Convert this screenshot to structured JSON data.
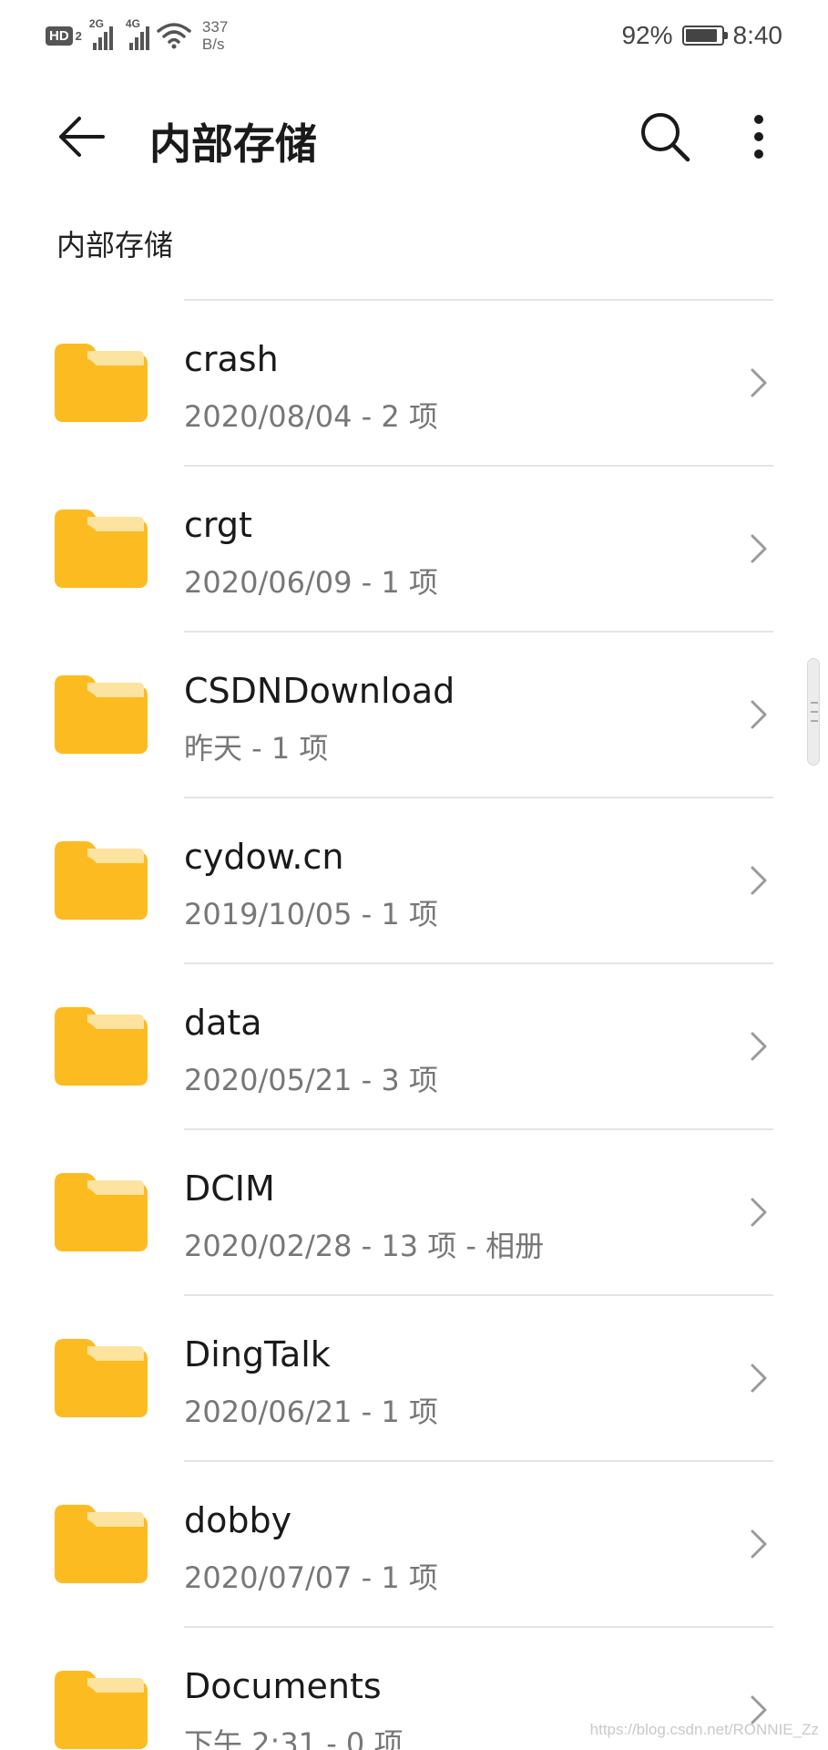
{
  "status_bar": {
    "hd_label": "HD",
    "hd_sub": "2",
    "net1": "2G",
    "net2": "4G",
    "speed_value": "337",
    "speed_unit": "B/s",
    "battery_percent": "92%",
    "battery_level": 0.92,
    "time": "8:40"
  },
  "app_bar": {
    "title": "内部存储",
    "back_icon": "arrow-left-icon",
    "search_icon": "search-icon",
    "more_icon": "more-vertical-icon"
  },
  "breadcrumb": "内部存储",
  "folder_color": "#FDBB22",
  "items": [
    {
      "name": "crash",
      "meta": "2020/08/04 - 2 项"
    },
    {
      "name": "crgt",
      "meta": "2020/06/09 - 1 项"
    },
    {
      "name": "CSDNDownload",
      "meta": "昨天 - 1 项"
    },
    {
      "name": "cydow.cn",
      "meta": "2019/10/05 - 1 项"
    },
    {
      "name": "data",
      "meta": "2020/05/21 - 3 项"
    },
    {
      "name": "DCIM",
      "meta": "2020/02/28 - 13 项 - 相册"
    },
    {
      "name": "DingTalk",
      "meta": "2020/06/21 - 1 项"
    },
    {
      "name": "dobby",
      "meta": "2020/07/07 - 1 项"
    },
    {
      "name": "Documents",
      "meta": "下午 2:31 - 0 项"
    }
  ],
  "watermark": "https://blog.csdn.net/RONNIE_Zz"
}
